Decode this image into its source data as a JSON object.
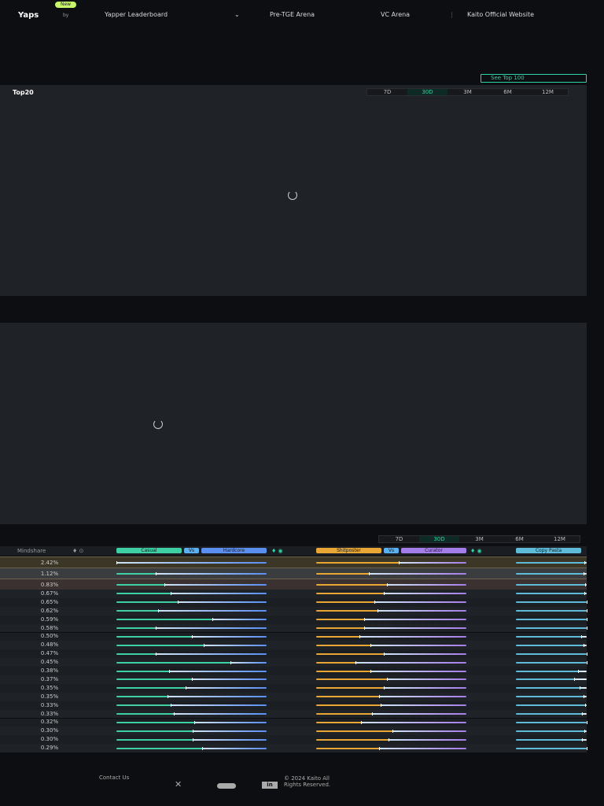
{
  "nav": {
    "badge": "New",
    "logo": "Yaps",
    "by": "by",
    "items": [
      "Yapper Leaderboard",
      "Pre-TGE Arena",
      "VC Arena",
      "Kaito Official Website"
    ]
  },
  "see_top": "See Top 100",
  "panel1": {
    "title": "Top20",
    "tabs": [
      "7D",
      "30D",
      "3M",
      "6M",
      "12M"
    ],
    "active": "30D"
  },
  "table": {
    "tabs": [
      "7D",
      "30D",
      "3M",
      "6M",
      "12M"
    ],
    "header": {
      "mindshare": "Mindshare",
      "casual": "Casual",
      "vs": "Vs",
      "hardcore": "Hardcore",
      "shitposter": "Shitposter",
      "curator": "Curator",
      "copypasta": "Copy Pasta"
    },
    "colors": {
      "casual": "#3ecfa4",
      "hardcore": "#5a8ff0",
      "shitposter": "#e8a634",
      "curator": "#a57de8",
      "copypasta": "#5fbcd8"
    },
    "rows": [
      {
        "m": "2.42%",
        "c": 0.0,
        "s": 0.55,
        "p": 0.97
      },
      {
        "m": "1.12%",
        "c": 0.26,
        "s": 0.35,
        "p": 0.96
      },
      {
        "m": "0.83%",
        "c": 0.32,
        "s": 0.47,
        "p": 0.98
      },
      {
        "m": "0.67%",
        "c": 0.36,
        "s": 0.45,
        "p": 0.97
      },
      {
        "m": "0.65%",
        "c": 0.41,
        "s": 0.39,
        "p": 1.0
      },
      {
        "m": "0.62%",
        "c": 0.28,
        "s": 0.41,
        "p": 1.0
      },
      {
        "m": "0.59%",
        "c": 0.64,
        "s": 0.32,
        "p": 1.0
      },
      {
        "m": "0.58%",
        "c": 0.26,
        "s": 0.32,
        "p": 1.0
      },
      {
        "m": "0.50%",
        "c": 0.5,
        "s": 0.29,
        "p": 0.92
      },
      {
        "m": "0.48%",
        "c": 0.58,
        "s": 0.36,
        "p": 0.95
      },
      {
        "m": "0.47%",
        "c": 0.26,
        "s": 0.45,
        "p": 1.0
      },
      {
        "m": "0.45%",
        "c": 0.76,
        "s": 0.26,
        "p": 1.0
      },
      {
        "m": "0.38%",
        "c": 0.35,
        "s": 0.36,
        "p": 0.88
      },
      {
        "m": "0.37%",
        "c": 0.5,
        "s": 0.47,
        "p": 0.82
      },
      {
        "m": "0.35%",
        "c": 0.46,
        "s": 0.45,
        "p": 0.9
      },
      {
        "m": "0.35%",
        "c": 0.34,
        "s": 0.42,
        "p": 0.95
      },
      {
        "m": "0.33%",
        "c": 0.36,
        "s": 0.43,
        "p": 0.98
      },
      {
        "m": "0.33%",
        "c": 0.38,
        "s": 0.37,
        "p": 0.93
      },
      {
        "m": "0.32%",
        "c": 0.52,
        "s": 0.3,
        "p": 1.0
      },
      {
        "m": "0.30%",
        "c": 0.51,
        "s": 0.51,
        "p": 0.97
      },
      {
        "m": "0.30%",
        "c": 0.51,
        "s": 0.48,
        "p": 0.93
      },
      {
        "m": "0.29%",
        "c": 0.57,
        "s": 0.42,
        "p": 1.0
      }
    ]
  },
  "footer": {
    "contact": "Contact Us",
    "copyright": "© 2024 Kaito All Rights Reserved."
  }
}
